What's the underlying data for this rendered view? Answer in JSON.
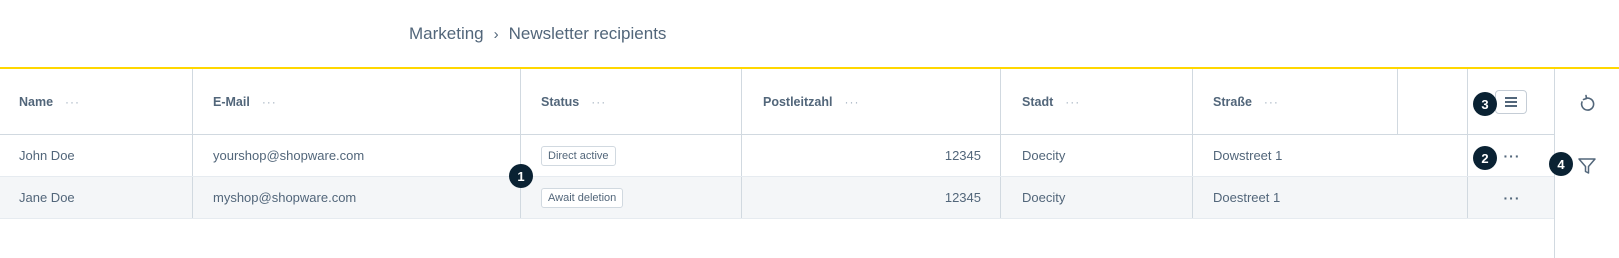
{
  "breadcrumb": {
    "parent": "Marketing",
    "separator": "›",
    "current": "Newsletter recipients"
  },
  "columns": [
    {
      "label": "Name",
      "dots": "···"
    },
    {
      "label": "E-Mail",
      "dots": "···"
    },
    {
      "label": "Status",
      "dots": "···"
    },
    {
      "label": "Postleitzahl",
      "dots": "···"
    },
    {
      "label": "Stadt",
      "dots": "···"
    },
    {
      "label": "Straße",
      "dots": "···"
    }
  ],
  "rows": [
    {
      "name": "John Doe",
      "email": "yourshop@shopware.com",
      "status": "Direct active",
      "zip": "12345",
      "city": "Doecity",
      "street": "Dowstreet 1",
      "actions": "···"
    },
    {
      "name": "Jane Doe",
      "email": "myshop@shopware.com",
      "status": "Await deletion",
      "zip": "12345",
      "city": "Doecity",
      "street": "Doestreet 1",
      "actions": "···"
    }
  ],
  "markers": [
    "1",
    "2",
    "3",
    "4"
  ],
  "icons": {
    "settings": "hamburger-menu-icon",
    "refresh": "refresh-icon",
    "filter": "filter-icon"
  },
  "colors": {
    "accent": "#ffd700",
    "marker": "#0a2233",
    "text": "#52667a",
    "row_alt": "#f4f6f8"
  }
}
